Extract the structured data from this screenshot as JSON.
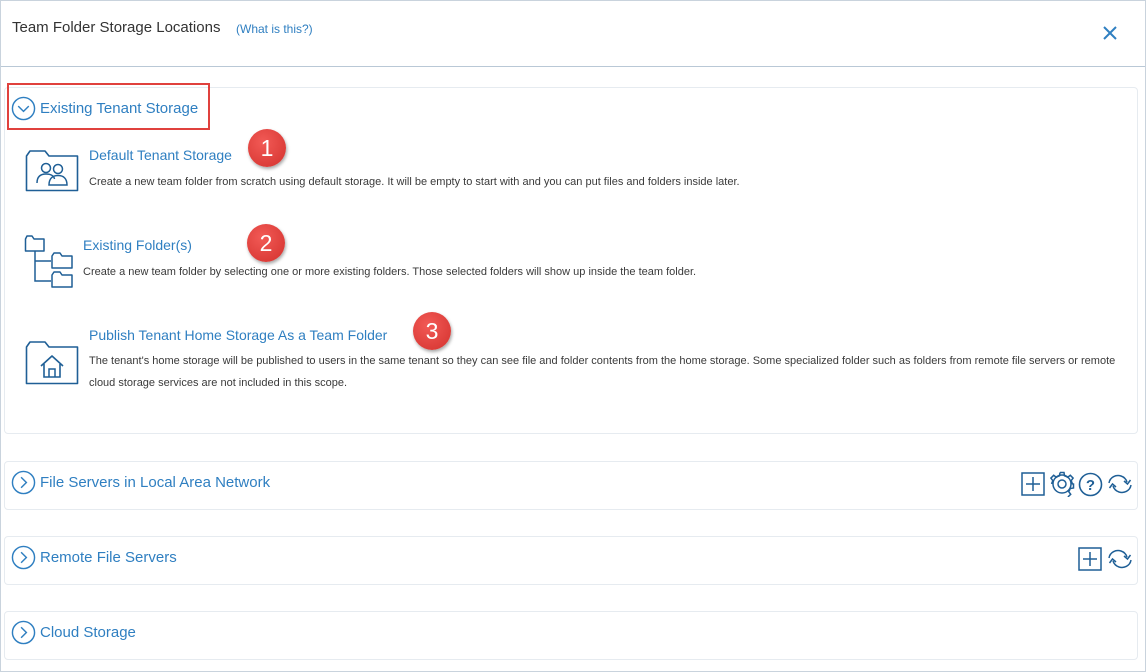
{
  "header": {
    "title": "Team Folder Storage Locations",
    "what_is_this": "(What is this?)",
    "close_icon": "close-icon"
  },
  "sections": {
    "existing_tenant": {
      "label": "Existing Tenant Storage",
      "expanded": true,
      "items": [
        {
          "title": "Default Tenant Storage",
          "description": "Create a new team folder from scratch using default storage. It will be empty to start with and you can put files and folders inside later.",
          "icon": "folder-users-icon",
          "badge": "1"
        },
        {
          "title": "Existing Folder(s)",
          "description": "Create a new team folder by selecting one or more existing folders. Those selected folders will show up inside the team folder.",
          "icon": "folder-tree-icon",
          "badge": "2"
        },
        {
          "title": "Publish Tenant Home Storage As a Team Folder",
          "description": "The tenant's home storage will be published to users in the same tenant so they can see file and folder contents from the home storage. Some specialized folder such as folders from remote file servers or remote cloud storage services are not included in this scope.",
          "icon": "folder-home-icon",
          "badge": "3"
        }
      ]
    },
    "lan": {
      "label": "File Servers in Local Area Network",
      "expanded": false,
      "tools": [
        "add-icon",
        "gear-icon",
        "help-icon",
        "refresh-icon"
      ]
    },
    "remote": {
      "label": "Remote File Servers",
      "expanded": false,
      "tools": [
        "add-icon",
        "refresh-icon"
      ]
    },
    "cloud": {
      "label": "Cloud Storage",
      "expanded": false
    }
  },
  "colors": {
    "accent": "#2f7fc1",
    "annotation": "#e0413d"
  }
}
